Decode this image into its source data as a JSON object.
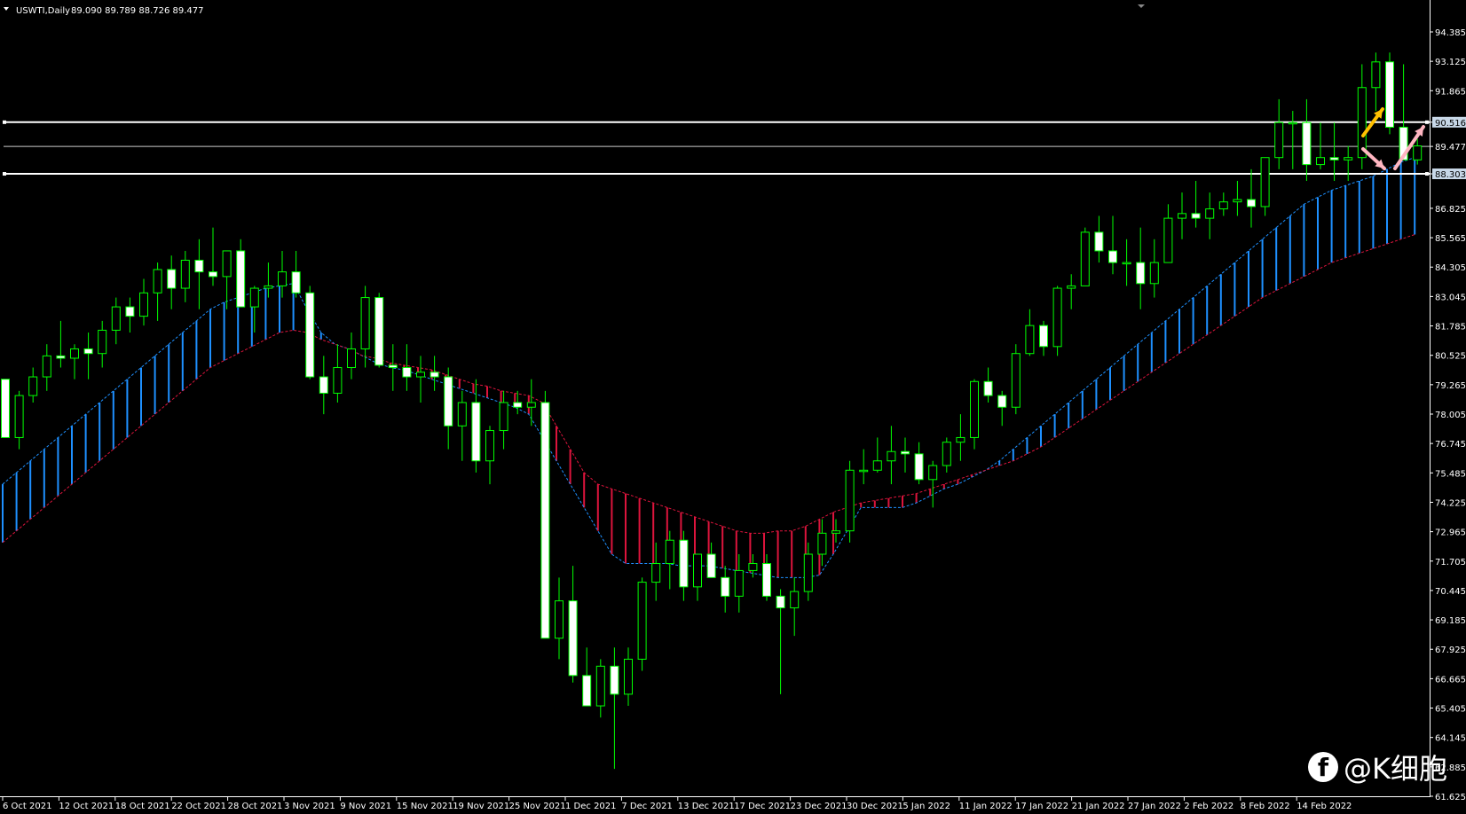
{
  "header": {
    "symbol": "USWTI,Daily",
    "ohlc": "89.090 89.789 88.726 89.477"
  },
  "watermark": {
    "text": "@K细胞",
    "icon": "facebook-icon"
  },
  "colors": {
    "background": "#000000",
    "bull_candle": "#000000",
    "bear_candle": "#ffffff",
    "wick": "#00ff00",
    "cloud_up": "#1e90ff",
    "cloud_down": "#dc143c",
    "level_line": "#ffffff",
    "arrow_yellow": "#ffc000",
    "arrow_pink": "#ffb6c1"
  },
  "chart_data": {
    "type": "candlestick",
    "y_axis": {
      "min": 61.625,
      "max": 95.5,
      "ticks": [
        "94.385",
        "93.125",
        "91.865",
        "90.516",
        "89.477",
        "88.303",
        "86.825",
        "85.565",
        "84.305",
        "83.045",
        "81.785",
        "80.525",
        "79.265",
        "78.005",
        "76.745",
        "75.485",
        "74.225",
        "72.965",
        "71.705",
        "70.445",
        "69.185",
        "67.925",
        "66.665",
        "65.405",
        "64.145",
        "62.885",
        "61.625"
      ]
    },
    "x_labels": [
      "6 Oct 2021",
      "12 Oct 2021",
      "18 Oct 2021",
      "22 Oct 2021",
      "28 Oct 2021",
      "3 Nov 2021",
      "9 Nov 2021",
      "15 Nov 2021",
      "19 Nov 2021",
      "25 Nov 2021",
      "1 Dec 2021",
      "7 Dec 2021",
      "13 Dec 2021",
      "17 Dec 2021",
      "23 Dec 2021",
      "30 Dec 2021",
      "5 Jan 2022",
      "11 Jan 2022",
      "17 Jan 2022",
      "21 Jan 2022",
      "27 Jan 2022",
      "2 Feb 2022",
      "8 Feb 2022",
      "14 Feb 2022"
    ],
    "levels": [
      {
        "label": "90.516",
        "value": 90.516
      },
      {
        "label": "89.477",
        "value": 89.477
      },
      {
        "label": "88.303",
        "value": 88.303
      }
    ],
    "candles": [
      [
        79.5,
        79.5,
        77.0,
        77.0
      ],
      [
        77.0,
        79.0,
        76.5,
        78.8
      ],
      [
        78.8,
        80.0,
        78.5,
        79.6
      ],
      [
        79.6,
        81.0,
        79.0,
        80.5
      ],
      [
        80.5,
        82.0,
        80.0,
        80.4
      ],
      [
        80.4,
        81.0,
        79.5,
        80.8
      ],
      [
        80.8,
        81.5,
        79.5,
        80.6
      ],
      [
        80.6,
        82.0,
        80.0,
        81.6
      ],
      [
        81.6,
        83.0,
        81.0,
        82.6
      ],
      [
        82.6,
        83.0,
        81.5,
        82.2
      ],
      [
        82.2,
        83.8,
        81.8,
        83.2
      ],
      [
        83.2,
        84.5,
        82.0,
        84.2
      ],
      [
        84.2,
        84.8,
        82.5,
        83.4
      ],
      [
        83.4,
        85.0,
        82.8,
        84.6
      ],
      [
        84.6,
        85.5,
        82.5,
        84.1
      ],
      [
        84.1,
        86.0,
        83.5,
        83.9
      ],
      [
        83.9,
        85.0,
        82.5,
        85.0
      ],
      [
        85.0,
        85.5,
        83.0,
        82.6
      ],
      [
        82.6,
        83.5,
        81.5,
        83.4
      ],
      [
        83.4,
        84.5,
        83.0,
        83.5
      ],
      [
        83.5,
        85.0,
        83.0,
        84.1
      ],
      [
        84.1,
        85.0,
        83.0,
        83.2
      ],
      [
        83.2,
        83.5,
        79.5,
        79.6
      ],
      [
        79.6,
        80.5,
        78.0,
        78.9
      ],
      [
        78.9,
        81.0,
        78.5,
        80.0
      ],
      [
        80.0,
        81.5,
        79.5,
        80.8
      ],
      [
        80.8,
        83.5,
        80.0,
        83.0
      ],
      [
        83.0,
        83.2,
        80.0,
        80.1
      ],
      [
        80.1,
        81.0,
        79.0,
        80.0
      ],
      [
        80.0,
        81.0,
        79.0,
        79.6
      ],
      [
        79.6,
        80.5,
        78.5,
        79.8
      ],
      [
        79.8,
        80.5,
        79.0,
        79.6
      ],
      [
        79.6,
        80.0,
        76.5,
        77.5
      ],
      [
        77.5,
        79.0,
        76.0,
        78.5
      ],
      [
        78.5,
        79.5,
        75.5,
        76.0
      ],
      [
        76.0,
        77.5,
        75.0,
        77.3
      ],
      [
        77.3,
        79.0,
        76.5,
        78.5
      ],
      [
        78.5,
        79.0,
        78.0,
        78.3
      ],
      [
        78.3,
        79.5,
        77.5,
        78.5
      ],
      [
        78.5,
        79.0,
        68.5,
        68.4
      ],
      [
        68.4,
        71.0,
        67.5,
        70.0
      ],
      [
        70.0,
        71.5,
        66.5,
        66.8
      ],
      [
        66.8,
        68.0,
        65.5,
        65.5
      ],
      [
        65.5,
        67.5,
        65.0,
        67.2
      ],
      [
        67.2,
        68.0,
        62.8,
        66.0
      ],
      [
        66.0,
        68.0,
        65.5,
        67.5
      ],
      [
        67.5,
        71.0,
        67.0,
        70.8
      ],
      [
        70.8,
        72.5,
        70.0,
        71.6
      ],
      [
        71.6,
        73.0,
        70.5,
        72.6
      ],
      [
        72.6,
        73.0,
        70.0,
        70.6
      ],
      [
        70.6,
        72.0,
        70.0,
        72.0
      ],
      [
        72.0,
        72.5,
        71.0,
        71.0
      ],
      [
        71.0,
        71.5,
        69.5,
        70.2
      ],
      [
        70.2,
        72.0,
        69.5,
        71.3
      ],
      [
        71.3,
        72.0,
        71.0,
        71.6
      ],
      [
        71.6,
        72.0,
        70.0,
        70.2
      ],
      [
        70.2,
        70.5,
        66.0,
        69.7
      ],
      [
        69.7,
        71.0,
        68.5,
        70.4
      ],
      [
        70.4,
        72.5,
        70.0,
        72.0
      ],
      [
        72.0,
        73.5,
        71.5,
        72.9
      ],
      [
        72.9,
        73.5,
        72.5,
        73.0
      ],
      [
        73.0,
        76.0,
        72.5,
        75.6
      ],
      [
        75.6,
        76.5,
        75.0,
        75.6
      ],
      [
        75.6,
        77.0,
        75.5,
        76.0
      ],
      [
        76.0,
        77.5,
        75.0,
        76.4
      ],
      [
        76.4,
        77.0,
        75.5,
        76.3
      ],
      [
        76.3,
        76.8,
        75.0,
        75.2
      ],
      [
        75.2,
        76.0,
        74.0,
        75.8
      ],
      [
        75.8,
        77.0,
        75.5,
        76.8
      ],
      [
        76.8,
        78.0,
        76.0,
        77.0
      ],
      [
        77.0,
        79.5,
        76.5,
        79.4
      ],
      [
        79.4,
        80.0,
        78.5,
        78.8
      ],
      [
        78.8,
        79.0,
        77.5,
        78.3
      ],
      [
        78.3,
        81.0,
        78.0,
        80.6
      ],
      [
        80.6,
        82.5,
        80.5,
        81.8
      ],
      [
        81.8,
        82.0,
        80.5,
        80.9
      ],
      [
        80.9,
        83.5,
        80.5,
        83.4
      ],
      [
        83.4,
        84.0,
        82.5,
        83.5
      ],
      [
        83.5,
        86.0,
        83.5,
        85.8
      ],
      [
        85.8,
        86.5,
        84.5,
        85.0
      ],
      [
        85.0,
        86.5,
        84.0,
        84.5
      ],
      [
        84.5,
        85.5,
        83.5,
        84.5
      ],
      [
        84.5,
        86.0,
        82.5,
        83.6
      ],
      [
        83.6,
        85.5,
        83.0,
        84.5
      ],
      [
        84.5,
        87.0,
        84.5,
        86.4
      ],
      [
        86.4,
        87.5,
        85.5,
        86.6
      ],
      [
        86.6,
        88.0,
        86.0,
        86.4
      ],
      [
        86.4,
        87.5,
        85.5,
        86.8
      ],
      [
        86.8,
        87.5,
        86.5,
        87.1
      ],
      [
        87.1,
        88.0,
        86.5,
        87.2
      ],
      [
        87.2,
        88.5,
        86.0,
        86.9
      ],
      [
        86.9,
        89.0,
        86.5,
        89.0
      ],
      [
        89.0,
        91.5,
        88.5,
        90.5
      ],
      [
        90.5,
        91.0,
        88.5,
        90.5
      ],
      [
        90.5,
        91.5,
        88.0,
        88.7
      ],
      [
        88.7,
        90.5,
        88.5,
        89.0
      ],
      [
        89.0,
        90.5,
        88.0,
        88.9
      ],
      [
        88.9,
        89.5,
        88.0,
        89.0
      ],
      [
        89.0,
        93.0,
        88.5,
        92.0
      ],
      [
        92.0,
        93.5,
        91.0,
        93.1
      ],
      [
        93.1,
        93.5,
        90.0,
        90.3
      ],
      [
        90.3,
        93.0,
        89.0,
        88.9
      ],
      [
        88.9,
        89.8,
        88.7,
        89.5
      ]
    ],
    "cloud": {
      "a": [
        75,
        75.5,
        76,
        76.5,
        77,
        77.5,
        78,
        78.5,
        79,
        79.5,
        80,
        80.5,
        81,
        81.5,
        82,
        82.5,
        82.8,
        83,
        83.2,
        83.4,
        83.5,
        83.6,
        82.5,
        81.5,
        81,
        80.8,
        80.5,
        80.2,
        80,
        79.9,
        79.7,
        79.5,
        79.3,
        79.1,
        78.9,
        78.7,
        78.5,
        78.3,
        78,
        77,
        76,
        75,
        74,
        73,
        72,
        71.6,
        71.6,
        71.6,
        71.6,
        71.5,
        71.5,
        71.5,
        71.4,
        71.3,
        71.2,
        71.1,
        71,
        71,
        71,
        71.1,
        72,
        73,
        74,
        74,
        74,
        74,
        74.2,
        74.5,
        74.8,
        75,
        75.3,
        75.6,
        76,
        76.5,
        77,
        77.5,
        78,
        78.5,
        79,
        79.5,
        80,
        80.5,
        81,
        81.5,
        82,
        82.5,
        83,
        83.5,
        84,
        84.5,
        85,
        85.5,
        86,
        86.5,
        87,
        87.3,
        87.6,
        87.8,
        88,
        88.2,
        88.5,
        88.8,
        89
      ],
      "b": [
        72.5,
        73,
        73.5,
        74,
        74.5,
        75,
        75.5,
        76,
        76.5,
        77,
        77.5,
        78,
        78.5,
        79,
        79.5,
        80,
        80.3,
        80.6,
        80.9,
        81.2,
        81.5,
        81.6,
        81.5,
        81.2,
        81,
        80.8,
        80.5,
        80.4,
        80.2,
        80.1,
        80,
        79.9,
        79.7,
        79.5,
        79.3,
        79.2,
        79,
        78.9,
        78.8,
        78.5,
        77.5,
        76.5,
        75.5,
        75,
        74.8,
        74.6,
        74.4,
        74.2,
        74,
        73.8,
        73.6,
        73.4,
        73.2,
        73,
        72.9,
        72.9,
        73,
        73,
        73.2,
        73.5,
        73.8,
        74,
        74.2,
        74.3,
        74.4,
        74.5,
        74.6,
        74.8,
        75,
        75.2,
        75.4,
        75.6,
        75.8,
        76,
        76.3,
        76.6,
        77,
        77.4,
        77.8,
        78.2,
        78.6,
        79,
        79.4,
        79.8,
        80.2,
        80.6,
        81,
        81.4,
        81.8,
        82.2,
        82.6,
        83,
        83.3,
        83.6,
        83.9,
        84.2,
        84.5,
        84.7,
        84.9,
        85.1,
        85.3,
        85.5,
        85.7
      ]
    },
    "annotations": [
      "yellow-arrow-up",
      "pink-arrow-down",
      "pink-arrow-up"
    ]
  }
}
